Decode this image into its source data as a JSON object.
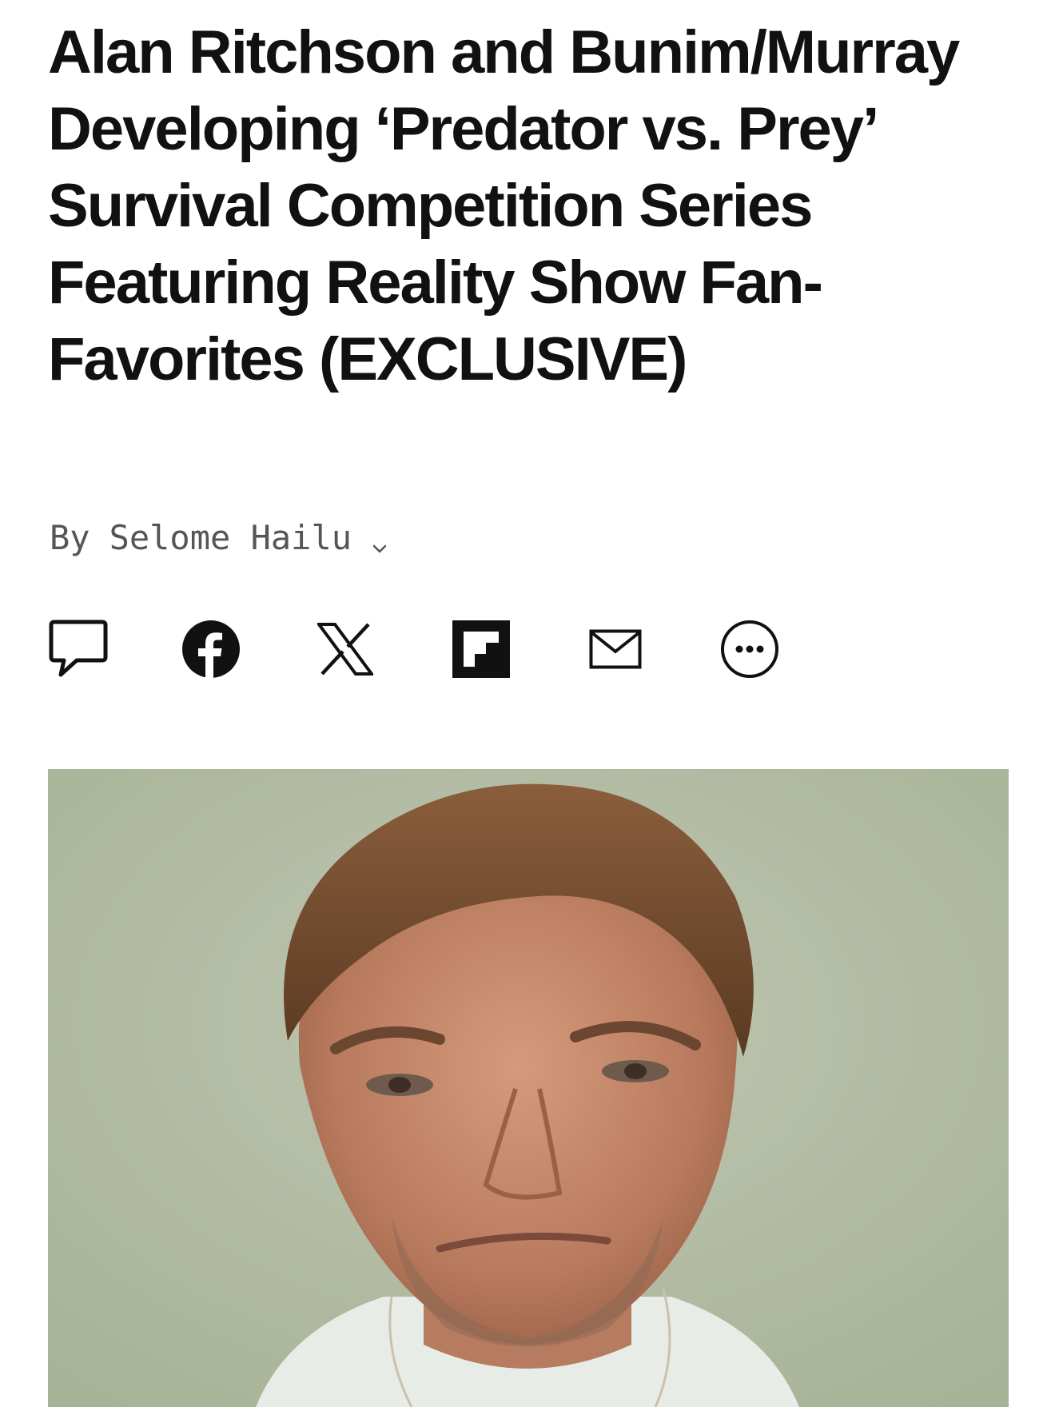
{
  "article": {
    "headline": "Alan Ritchson and Bunim/Murray Developing ‘Predator vs. Prey’ Survival Competition Series Featuring Reality Show Fan-Favorites (EXCLUSIVE)",
    "byline_prefix": "By",
    "author": "Selome Hailu"
  },
  "share": {
    "items": [
      {
        "name": "comments",
        "icon": "comment-icon"
      },
      {
        "name": "facebook",
        "icon": "facebook-icon"
      },
      {
        "name": "x",
        "icon": "x-icon"
      },
      {
        "name": "flipboard",
        "icon": "flipboard-icon"
      },
      {
        "name": "email",
        "icon": "email-icon"
      },
      {
        "name": "more",
        "icon": "more-icon"
      }
    ]
  },
  "hero_image": {
    "subject": "portrait photo",
    "background_color": "#b1bba2"
  },
  "colors": {
    "text": "#111111",
    "byline": "#555555",
    "icon": "#111111"
  }
}
